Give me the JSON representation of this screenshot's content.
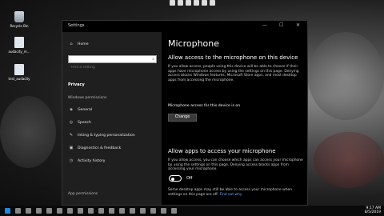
{
  "desktop": {
    "icons": [
      {
        "label": "Recycle Bin"
      },
      {
        "label": "audacity_m..."
      },
      {
        "label": "test_audacity"
      }
    ]
  },
  "window": {
    "title": "Settings",
    "controls": {
      "minimize": "—",
      "maximize": "☐",
      "close": "✕"
    }
  },
  "nav": {
    "home": "Home",
    "search_placeholder": "Find a setting",
    "section_title": "Privacy",
    "windows_permissions_label": "Windows permissions",
    "items": [
      "General",
      "Speech",
      "Inking & typing personalization",
      "Diagnostics & feedback",
      "Activity history"
    ],
    "app_permissions_label": "App permissions"
  },
  "content": {
    "page_title": "Microphone",
    "section1_title": "Allow access to the microphone on this device",
    "section1_body": "If you allow access, people using this device will be able to choose if their apps have microphone access by using the settings on this page. Denying access blocks Windows features, Microsoft Store apps, and most desktop apps from accessing the microphone.",
    "device_status": "Microphone access for this device is on",
    "change_button": "Change",
    "section2_title": "Allow apps to access your microphone",
    "section2_body": "If you allow access, you can choose which apps can access your microphone by using the settings on this page. Denying access blocks apps from accessing your microphone.",
    "toggle_state": "Off",
    "footer_note": "Some desktop apps may still be able to access your microphone when settings on this page are off.",
    "footer_link": "Find out why"
  },
  "taskbar": {
    "clock": "9:17 AM",
    "date": "8/5/2019"
  }
}
